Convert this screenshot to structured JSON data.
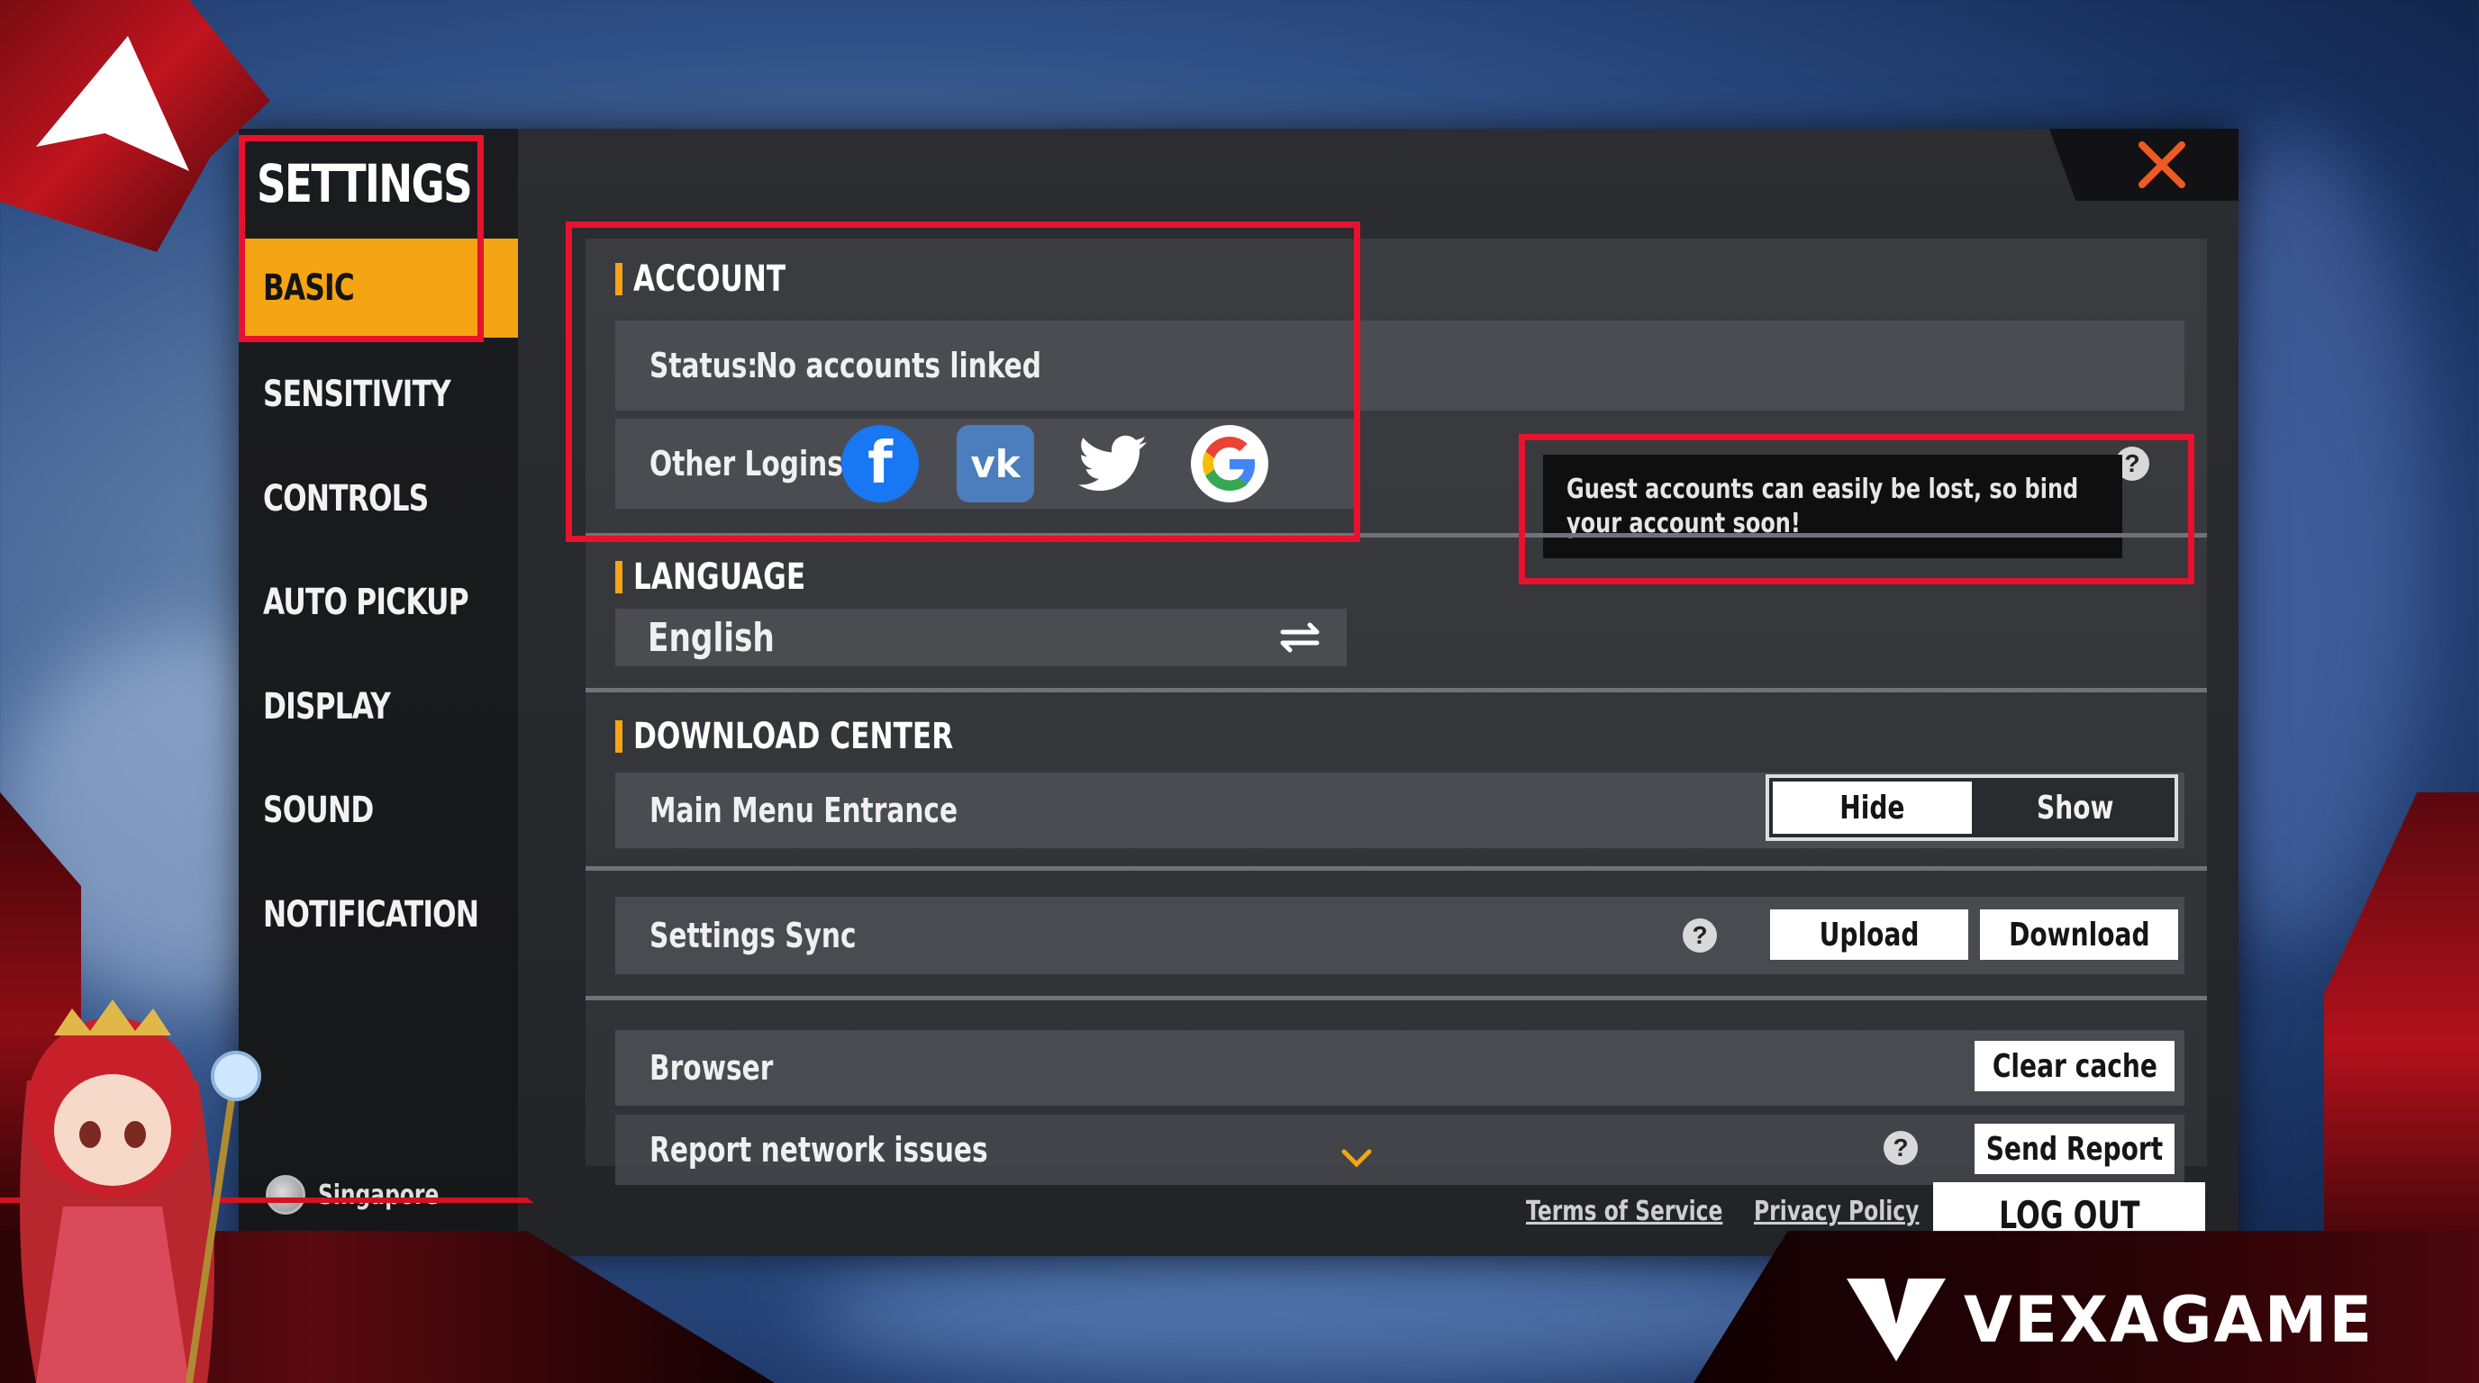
{
  "window": {
    "title": "SETTINGS"
  },
  "sidebar": {
    "items": [
      {
        "label": "BASIC",
        "active": true
      },
      {
        "label": "SENSITIVITY",
        "active": false
      },
      {
        "label": "CONTROLS",
        "active": false
      },
      {
        "label": "AUTO PICKUP",
        "active": false
      },
      {
        "label": "DISPLAY",
        "active": false
      },
      {
        "label": "SOUND",
        "active": false
      },
      {
        "label": "NOTIFICATION",
        "active": false
      }
    ],
    "region": "Singapore"
  },
  "account": {
    "heading": "ACCOUNT",
    "status_label": "Status:",
    "status_value": "No accounts linked",
    "other_logins_label": "Other Logins:",
    "logins": [
      "facebook-icon",
      "vk-icon",
      "twitter-icon",
      "google-icon"
    ],
    "tooltip": "Guest accounts can easily be lost, so bind your account soon!"
  },
  "language": {
    "heading": "LANGUAGE",
    "value": "English"
  },
  "download_center": {
    "heading": "DOWNLOAD CENTER",
    "main_menu_label": "Main Menu Entrance",
    "toggle": {
      "selected": "Hide",
      "other": "Show"
    }
  },
  "settings_sync": {
    "label": "Settings Sync",
    "upload": "Upload",
    "download": "Download"
  },
  "browser": {
    "label": "Browser",
    "clear_cache": "Clear cache"
  },
  "report": {
    "label": "Report network issues",
    "send": "Send Report"
  },
  "footer": {
    "terms": "Terms of Service",
    "privacy": "Privacy Policy",
    "logout": "LOG OUT"
  },
  "watermark": "VEXAGAME",
  "colors": {
    "accent": "#f5a414",
    "highlight": "#e8122e",
    "close": "#f05a22"
  }
}
